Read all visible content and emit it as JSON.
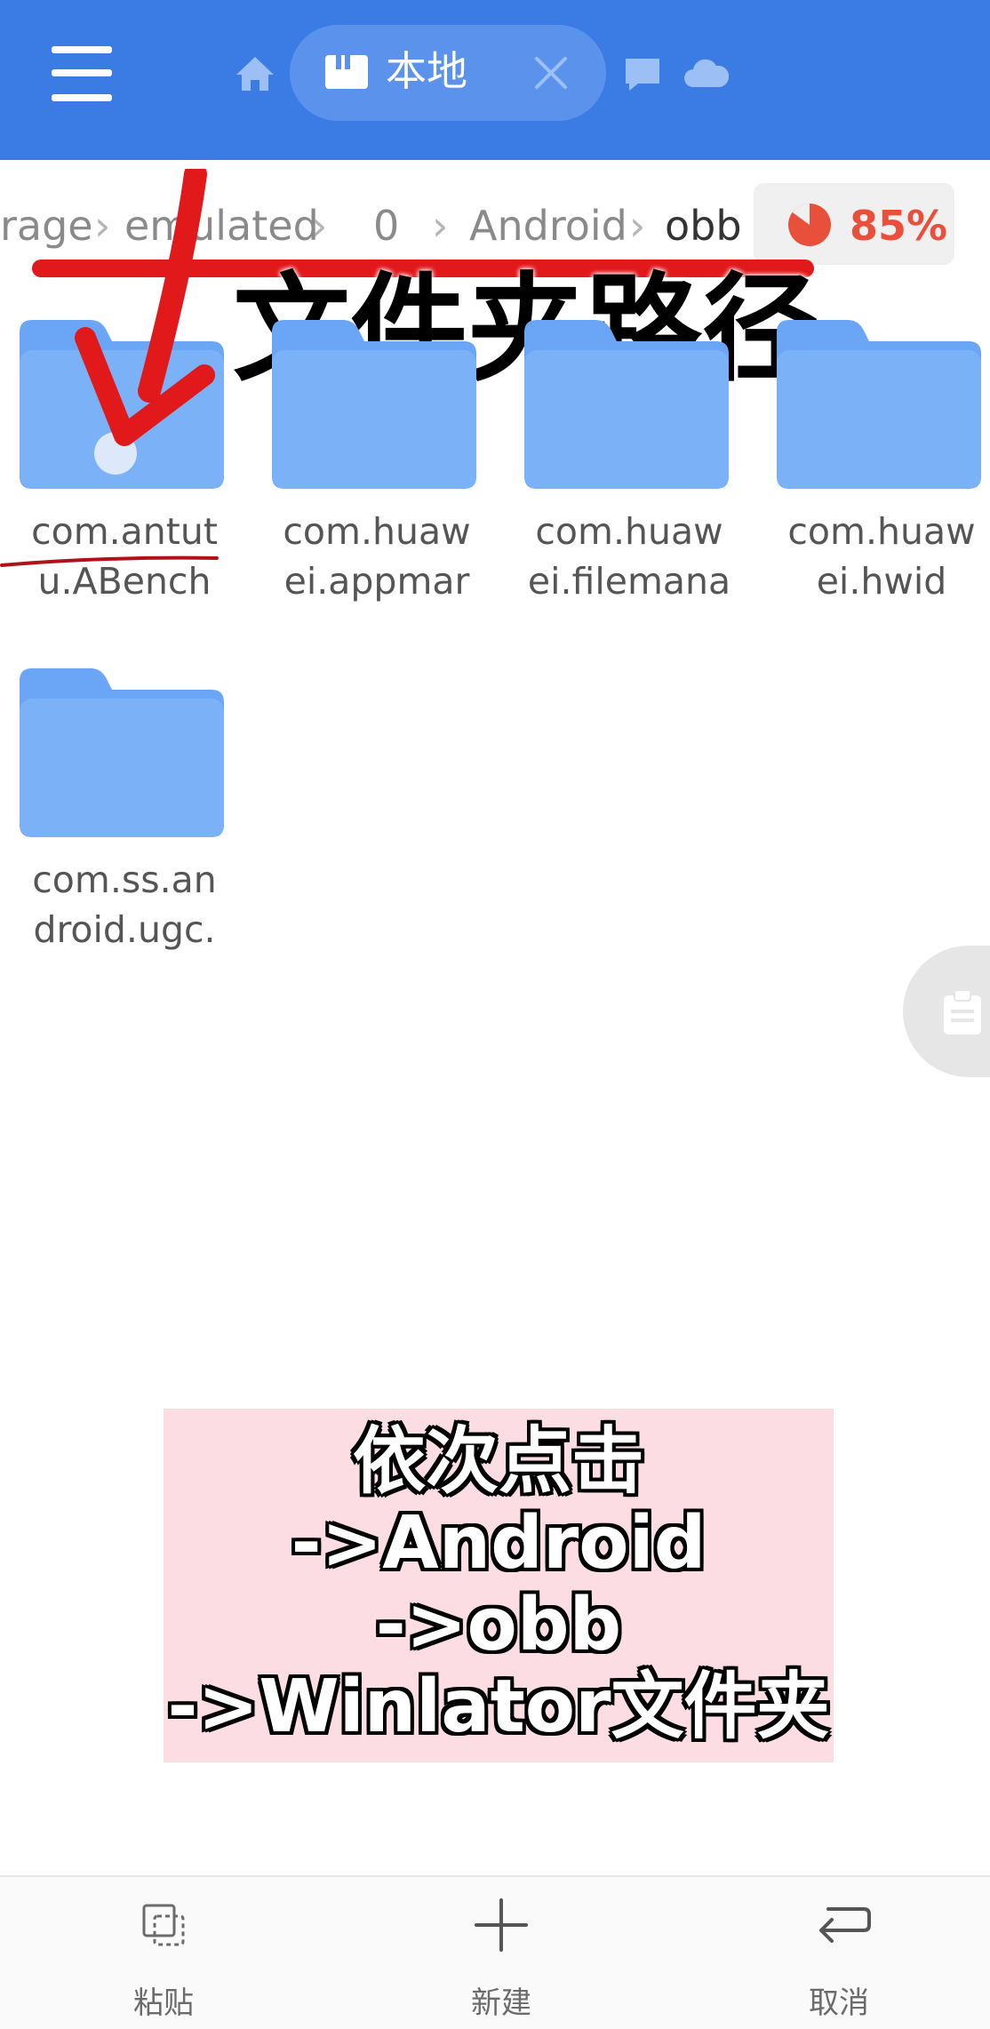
{
  "header": {
    "tab_label": "本地",
    "colors": {
      "bar": "#3a7be4",
      "pill": "#5b93ec"
    },
    "icons": [
      "menu-icon",
      "home-icon",
      "sd-card-icon",
      "close-icon",
      "chat-icon",
      "cloud-icon"
    ]
  },
  "breadcrumb": {
    "items": [
      "rage",
      "emulated",
      "0",
      "Android",
      "obb"
    ],
    "storage_used": "85%",
    "storage_used_fraction": 0.85
  },
  "annotation": {
    "title": "文件夹路径",
    "color": "#e1191b"
  },
  "folders": [
    {
      "name_line1": "com.antut",
      "name_line2": "u.ABench"
    },
    {
      "name_line1": "com.huaw",
      "name_line2": "ei.appmar"
    },
    {
      "name_line1": "com.huaw",
      "name_line2": "ei.filemana"
    },
    {
      "name_line1": "com.huaw",
      "name_line2": "ei.hwid"
    },
    {
      "name_line1": "com.ss.an",
      "name_line2": "droid.ugc."
    }
  ],
  "hint": {
    "lines": [
      "依次点击",
      "->Android",
      "->obb",
      "->Winlator文件夹"
    ]
  },
  "bottom_bar": {
    "paste": "粘贴",
    "new": "新建",
    "cancel": "取消"
  }
}
